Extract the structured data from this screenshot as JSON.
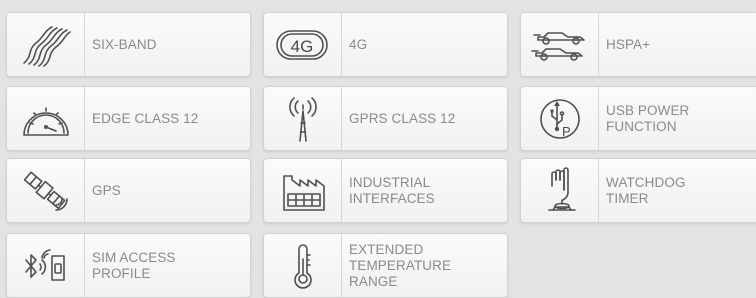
{
  "features": [
    {
      "label": "SIX-BAND",
      "icon": "waves-icon"
    },
    {
      "label": "4G",
      "icon": "4g-icon"
    },
    {
      "label": "HSPA+",
      "icon": "race-car-icon"
    },
    {
      "label": "EDGE CLASS 12",
      "icon": "speedometer-icon"
    },
    {
      "label": "GPRS CLASS 12",
      "icon": "antenna-tower-icon"
    },
    {
      "label": "USB POWER\nFUNCTION",
      "icon": "usb-power-icon"
    },
    {
      "label": "GPS",
      "icon": "satellite-icon"
    },
    {
      "label": "INDUSTRIAL\nINTERFACES",
      "icon": "factory-icon"
    },
    {
      "label": "WATCHDOG\nTIMER",
      "icon": "press-button-icon"
    },
    {
      "label": "SIM ACCESS\nPROFILE",
      "icon": "bluetooth-sim-icon"
    },
    {
      "label": "EXTENDED\nTEMPERATURE\nRANGE",
      "icon": "thermometer-icon"
    }
  ],
  "icon_texts": {
    "four_g": "4G",
    "usb_p": "P"
  },
  "colors": {
    "background": "#e3e3e3",
    "card": "#f6f6f6",
    "icon": "#505050",
    "label": "#8a8a8a"
  }
}
